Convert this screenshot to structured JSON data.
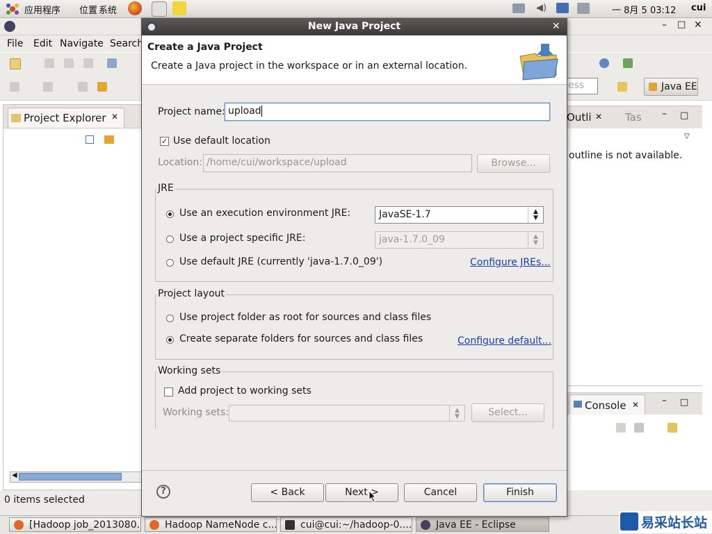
{
  "top_panel": {
    "menus": [
      "应用程序",
      "位置",
      "系统"
    ],
    "clock": "一 8月 5 03:12",
    "user": "cui"
  },
  "eclipse": {
    "menu": [
      "File",
      "Edit",
      "Navigate",
      "Search"
    ],
    "project_explorer": {
      "tab_label": "Project Explorer"
    },
    "perspective_label": "Java EE",
    "quick_access_placeholder": "ess",
    "outline": {
      "tab_label": "Outli",
      "other_tab": "Tas",
      "message": "outline is not available."
    },
    "console": {
      "tab_label": "Console"
    },
    "status": "0 items selected"
  },
  "dialog": {
    "title": "New Java Project",
    "header_title": "Create a Java Project",
    "header_desc": "Create a Java project in the workspace or in an external location.",
    "project_name_label": "Project name:",
    "project_name_value": "upload",
    "use_default_location_label": "Use default location",
    "use_default_location_checked": true,
    "location_label": "Location:",
    "location_value": "/home/cui/workspace/upload",
    "browse_label": "Browse...",
    "jre_group": "JRE",
    "jre_options": [
      {
        "label": "Use an execution environment JRE:",
        "selected": true,
        "combo": "JavaSE-1.7"
      },
      {
        "label": "Use a project specific JRE:",
        "selected": false,
        "combo": "java-1.7.0_09"
      },
      {
        "label": "Use default JRE (currently 'java-1.7.0_09')",
        "selected": false
      }
    ],
    "configure_jres": "Configure JREs...",
    "layout_group": "Project layout",
    "layout_options": [
      {
        "label": "Use project folder as root for sources and class files",
        "selected": false
      },
      {
        "label": "Create separate folders for sources and class files",
        "selected": true
      }
    ],
    "configure_default": "Configure default...",
    "working_sets_group": "Working sets",
    "add_to_working_sets": "Add project to working sets",
    "working_sets_label": "Working sets:",
    "select_label": "Select...",
    "buttons": {
      "back": "< Back",
      "next": "Next >",
      "cancel": "Cancel",
      "finish": "Finish"
    }
  },
  "taskbar": [
    {
      "label": "[Hadoop job_2013080...",
      "icon": "firefox-icon"
    },
    {
      "label": "Hadoop NameNode c...",
      "icon": "firefox-icon"
    },
    {
      "label": "cui@cui:~/hadoop-0....",
      "icon": "terminal-icon"
    },
    {
      "label": "Java EE - Eclipse",
      "icon": "eclipse-icon",
      "active": true
    }
  ],
  "watermark": "易采站长站",
  "colors": {
    "link": "#1a3cbf",
    "dialog_title_bg": "#3a3936",
    "scroll_thumb": "#86a9d6"
  }
}
